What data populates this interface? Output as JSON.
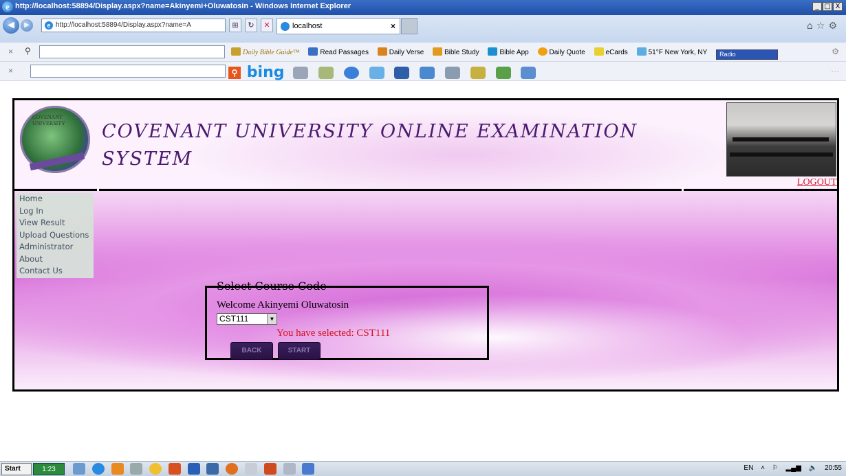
{
  "browser": {
    "window_title": "http://localhost:58894/Display.aspx?name=Akinyemi+Oluwatosin - Windows Internet Explorer",
    "address": "http://localhost:58894/Display.aspx?name=A",
    "tab_label": "localhost",
    "toolbar_items": [
      "Daily Bible Guide™",
      "Read Passages",
      "Daily Verse",
      "Bible Study",
      "Bible App",
      "Daily Quote",
      "eCards",
      "51°F New York, NY"
    ],
    "radio_label": "Radio",
    "bing_label": "bing",
    "win_min": "_",
    "win_max": "□",
    "win_close": "X"
  },
  "page": {
    "title": "COVENANT UNIVERSITY ONLINE EXAMINATION SYSTEM",
    "logo_text": "COVENANT UNIVERSITY",
    "logout": "LOGOUT",
    "menu": [
      "Home",
      "Log In",
      "View Result",
      "Upload Questions",
      "Administrator",
      "About",
      "Contact Us"
    ],
    "form": {
      "legend": "Select Course Code",
      "welcome": "Welcome Akinyemi Oluwatosin",
      "selected_course": "CST111",
      "selected_message": "You have selected: CST111",
      "back_label": "BACK",
      "start_label": "START"
    }
  },
  "taskbar": {
    "start_label": "Start",
    "active_label": "1:23",
    "language": "EN",
    "clock": "20:55"
  },
  "colors": {
    "title_text": "#4a1a70",
    "logout": "#d01c2c",
    "message": "#d6101c",
    "button": "#2a1244"
  }
}
